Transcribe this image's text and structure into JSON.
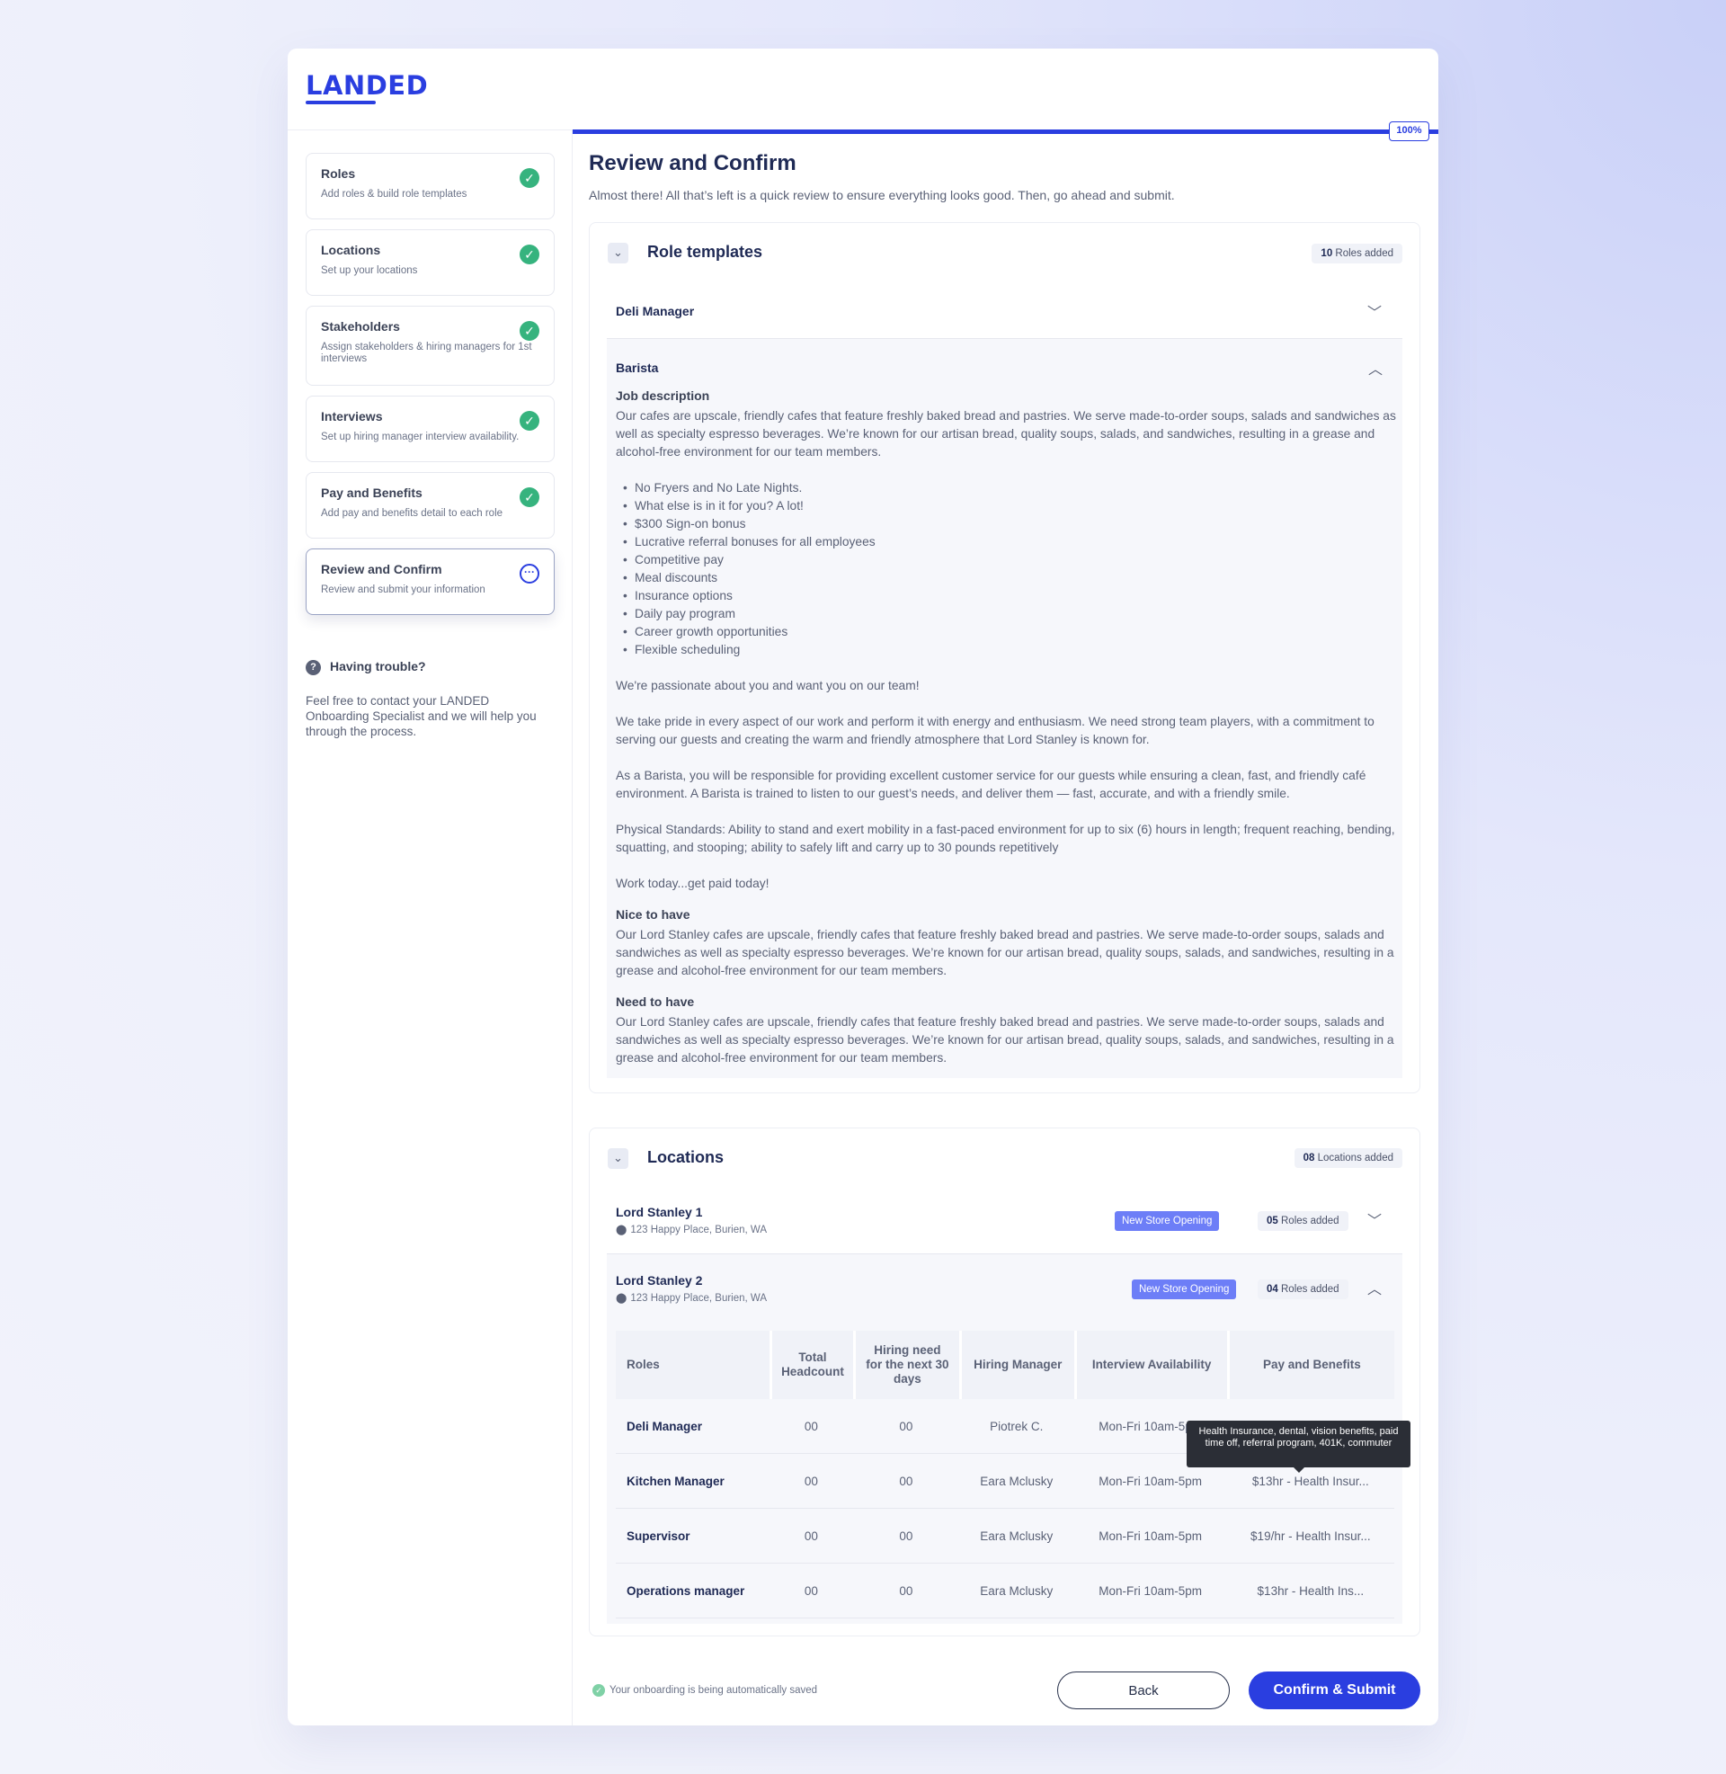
{
  "brand": {
    "logo": "LANDED",
    "accent": "#2a3ee0"
  },
  "sidebar": {
    "steps": [
      {
        "title": "Roles",
        "subtitle": "Add roles & build role templates",
        "status": "complete",
        "icon": "check-circle-icon"
      },
      {
        "title": "Locations",
        "subtitle": "Set up your locations",
        "status": "complete",
        "icon": "check-circle-icon"
      },
      {
        "title": "Stakeholders",
        "subtitle": "Assign stakeholders & hiring managers for 1st interviews",
        "status": "complete",
        "icon": "check-circle-icon"
      },
      {
        "title": "Interviews",
        "subtitle": "Set up hiring manager interview availability.",
        "status": "complete",
        "icon": "check-circle-icon"
      },
      {
        "title": "Pay and Benefits",
        "subtitle": "Add pay and benefits detail to each role",
        "status": "complete",
        "icon": "check-circle-icon"
      },
      {
        "title": "Review and Confirm",
        "subtitle": "Review and submit your information",
        "status": "in-progress",
        "icon": "more-dots-icon"
      }
    ],
    "trouble": {
      "title": "Having trouble?",
      "text": "Feel free to contact your LANDED Onboarding Specialist and we will help you through the process."
    }
  },
  "progress": {
    "percent": 100,
    "label": "100%"
  },
  "main": {
    "title": "Review and Confirm",
    "subtitle": "Almost there! All that’s left is a quick review to ensure everything looks good. Then, go ahead and submit."
  },
  "role_templates": {
    "title": "Role templates",
    "badge_count": "10",
    "badge_label": "Roles added",
    "roles": [
      {
        "name": "Deli Manager",
        "expanded": false
      },
      {
        "name": "Barista",
        "expanded": true
      }
    ],
    "barista": {
      "job_description_heading": "Job description",
      "intro": "Our cafes are upscale, friendly cafes that feature freshly baked bread and pastries. We serve made-to-order soups, salads and sandwiches as well as specialty espresso beverages. We’re known for our artisan bread, quality soups, salads, and sandwiches, resulting in a grease and alcohol-free environment for our team members.",
      "bullets": [
        "No Fryers and No Late Nights.",
        "What else is in it for you? A lot!",
        "$300 Sign-on bonus",
        "Lucrative referral bonuses for all employees",
        "Competitive pay",
        "Meal discounts",
        "Insurance options",
        "Daily pay program",
        "Career growth opportunities",
        "Flexible scheduling"
      ],
      "p1": "We're passionate about you and want you on our team!",
      "p2": "We take pride in every aspect of our work and perform it with energy and enthusiasm. We need strong team players, with a commitment to serving our guests and creating the warm and friendly atmosphere that Lord Stanley is known for.",
      "p3": "As a Barista, you will be responsible for providing excellent customer service for our guests while ensuring a clean, fast, and friendly café environment. A Barista is trained to listen to our guest’s needs, and deliver them — fast, accurate, and with a friendly smile.",
      "p4": "Physical Standards: Ability to stand and exert mobility in a fast-paced environment for up to six (6) hours in length; frequent reaching, bending, squatting, and stooping; ability to safely lift and carry up to 30 pounds repetitively",
      "p5": "Work today...get paid today!",
      "nice_heading": "Nice to have",
      "nice_text": "Our Lord Stanley cafes are upscale, friendly cafes that feature freshly baked bread and pastries. We serve made-to-order soups, salads and sandwiches as well as specialty espresso beverages. We’re known for our artisan bread, quality soups, salads, and sandwiches, resulting in a grease and alcohol-free environment for our team members.",
      "need_heading": "Need to have",
      "need_text": "Our Lord Stanley cafes are upscale, friendly cafes that feature freshly baked bread and pastries. We serve made-to-order soups, salads and sandwiches as well as specialty espresso beverages. We’re known for our artisan bread, quality soups, salads, and sandwiches, resulting in a grease and alcohol-free environment for our team members."
    }
  },
  "locations": {
    "title": "Locations",
    "badge_count": "08",
    "badge_label": "Locations added",
    "items": [
      {
        "name": "Lord Stanley 1",
        "address": "123 Happy Place, Burien, WA",
        "tag": "New Store Opening",
        "roles_count": "05",
        "roles_label": "Roles added",
        "expanded": false
      },
      {
        "name": "Lord Stanley 2",
        "address": "123 Happy Place, Burien, WA",
        "tag": "New Store Opening",
        "roles_count": "04",
        "roles_label": "Roles added",
        "expanded": true
      }
    ],
    "table": {
      "headers": [
        "Roles",
        "Total Headcount",
        "Hiring need for the next 30 days",
        "Hiring Manager",
        "Interview Availability",
        "Pay and Benefits"
      ],
      "rows": [
        [
          "Deli Manager",
          "00",
          "00",
          "Piotrek C.",
          "Mon-Fri 10am-5pm",
          ""
        ],
        [
          "Kitchen Manager",
          "00",
          "00",
          "Eara Mclusky",
          "Mon-Fri 10am-5pm",
          "$13hr - Health Insur..."
        ],
        [
          "Supervisor",
          "00",
          "00",
          "Eara Mclusky",
          "Mon-Fri 10am-5pm",
          "$19/hr - Health Insur..."
        ],
        [
          "Operations manager",
          "00",
          "00",
          "Eara Mclusky",
          "Mon-Fri 10am-5pm",
          "$13hr - Health Ins..."
        ]
      ],
      "tooltip": "Health Insurance, dental, vision benefits, paid time off, referral program, 401K, commuter"
    }
  },
  "footer": {
    "autosave": "Your onboarding is being automatically saved",
    "back": "Back",
    "submit": "Confirm & Submit"
  }
}
